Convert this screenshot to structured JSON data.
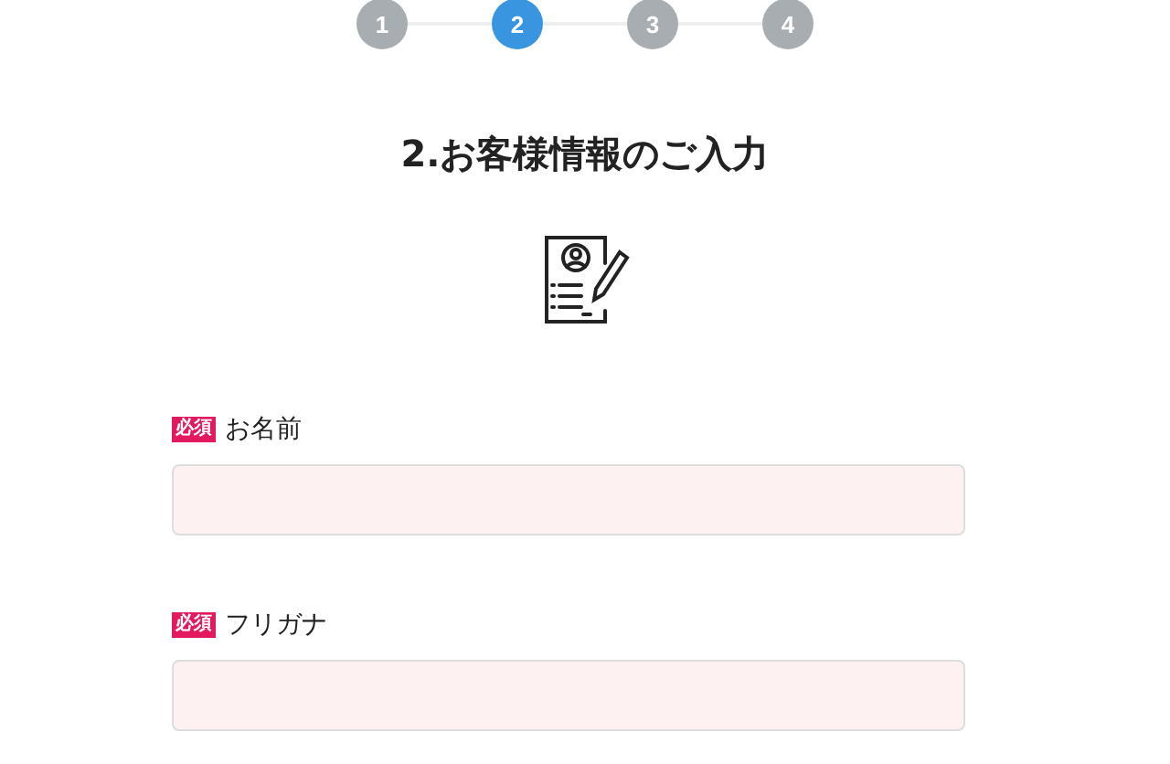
{
  "steps": [
    {
      "label": "1",
      "selected": false
    },
    {
      "label": "2",
      "selected": true
    },
    {
      "label": "3",
      "selected": false
    },
    {
      "label": "4",
      "selected": false
    }
  ],
  "title": "2.お客様情報のご入力",
  "fields": [
    {
      "badge": "必須",
      "label": "お名前"
    },
    {
      "badge": "必須",
      "label": "フリガナ"
    }
  ]
}
